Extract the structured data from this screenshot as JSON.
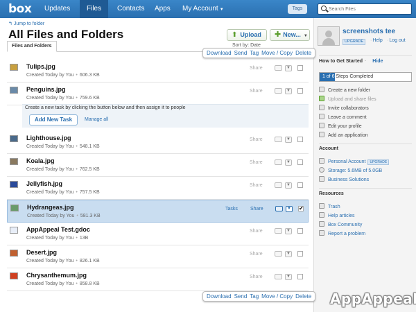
{
  "nav": {
    "logo": "box",
    "items": [
      {
        "label": "Updates"
      },
      {
        "label": "Files"
      },
      {
        "label": "Contacts"
      },
      {
        "label": "Apps"
      },
      {
        "label": "My Account"
      }
    ],
    "active_index": 1,
    "tags_label": "Tags",
    "search_placeholder": "Search Files"
  },
  "header": {
    "jump_link": "Jump to folder",
    "title": "All Files and Folders",
    "upload_label": "Upload",
    "new_label": "New...",
    "tab_label": "Files and Folders",
    "sort_label": "Sort by: Date"
  },
  "actions": [
    "Download",
    "Send",
    "Tag",
    "Move / Copy",
    "Delete"
  ],
  "files": [
    {
      "name": "Tulips.jpg",
      "meta": "Created Today by You",
      "size": "606.3 KB",
      "share": "Share",
      "tasks": "",
      "thumb": "#c8a040",
      "checked": false,
      "selected": false
    },
    {
      "name": "Penguins.jpg",
      "meta": "Created Today by You",
      "size": "759.6 KB",
      "share": "Share",
      "tasks": "",
      "thumb": "#6a8aa8",
      "checked": false,
      "selected": false
    },
    {
      "name": "Lighthouse.jpg",
      "meta": "Created Today by You",
      "size": "548.1 KB",
      "share": "Share",
      "tasks": "",
      "thumb": "#4a6a8a",
      "checked": false,
      "selected": false
    },
    {
      "name": "Koala.jpg",
      "meta": "Created Today by You",
      "size": "762.5 KB",
      "share": "Share",
      "tasks": "",
      "thumb": "#8a7a60",
      "checked": false,
      "selected": false
    },
    {
      "name": "Jellyfish.jpg",
      "meta": "Created Today by You",
      "size": "757.5 KB",
      "share": "Share",
      "tasks": "",
      "thumb": "#2a4a9a",
      "checked": false,
      "selected": false
    },
    {
      "name": "Hydrangeas.jpg",
      "meta": "Created Today by You",
      "size": "581.3 KB",
      "share": "Share",
      "tasks": "Tasks",
      "thumb": "#6a9a6a",
      "checked": true,
      "selected": true
    },
    {
      "name": "AppAppeal Test.gdoc",
      "meta": "Created Today by You",
      "size": "13B",
      "share": "Share",
      "tasks": "",
      "thumb": "#e8eef8",
      "checked": false,
      "selected": false
    },
    {
      "name": "Desert.jpg",
      "meta": "Created Today by You",
      "size": "826.1 KB",
      "share": "Share",
      "tasks": "",
      "thumb": "#c06030",
      "checked": false,
      "selected": false
    },
    {
      "name": "Chrysanthemum.jpg",
      "meta": "Created Today by You",
      "size": "858.8 KB",
      "share": "Share",
      "tasks": "",
      "thumb": "#d04020",
      "checked": false,
      "selected": false
    }
  ],
  "task_panel": {
    "hint": "Create a new task by clicking the button below and then assign it to people",
    "button": "Add New Task",
    "manage": "Manage all"
  },
  "user": {
    "name": "screenshots tee",
    "upgrade": "UPGRADE",
    "help": "Help",
    "logout": "Log out"
  },
  "getting_started": {
    "title": "How to Get Started",
    "hide": "Hide",
    "progress_text": "1 of 6",
    "progress_rest": "Steps Completed",
    "progress_fraction": 0.1667,
    "items": [
      {
        "label": "Create a new folder",
        "done": false
      },
      {
        "label": "Upload and share files",
        "done": true
      },
      {
        "label": "Invite collaborators",
        "done": false
      },
      {
        "label": "Leave a comment",
        "done": false
      },
      {
        "label": "Edit your profile",
        "done": false
      },
      {
        "label": "Add an application",
        "done": false
      }
    ]
  },
  "account": {
    "title": "Account",
    "plan": "Personal Account",
    "plan_badge": "UPGRADE",
    "storage": "Storage: 5.6MB of 5.0GB",
    "business": "Business Solutions"
  },
  "resources": {
    "title": "Resources",
    "items": [
      "Trash",
      "Help articles",
      "Box Community",
      "Report a problem"
    ]
  },
  "watermark": "AppAppeal",
  "colors": {
    "brand": "#2a6fb0",
    "nav": "#3a86c8",
    "selected_row": "#c9ddf0"
  }
}
